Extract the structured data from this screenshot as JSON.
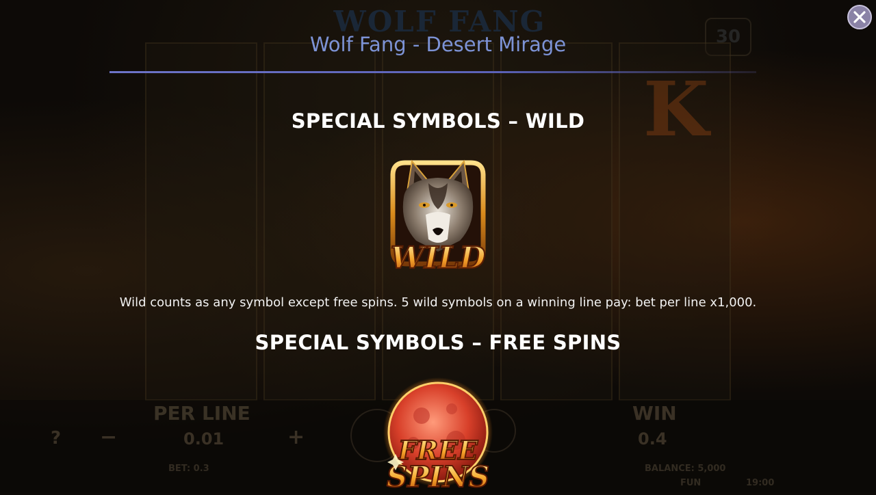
{
  "background": {
    "game_logo_text": "WOLF FANG",
    "lines_count": "30",
    "reel_letter": "K",
    "per_line_label": "PER LINE",
    "per_line_value": "0.01",
    "win_label": "WIN",
    "win_value": "0.4",
    "bet_text": "BET: 0.3",
    "balance_text": "BALANCE: 5,000",
    "fun_text": "FUN",
    "clock_text": "19:00",
    "help_glyph": "?",
    "minus_glyph": "−",
    "plus_glyph": "+"
  },
  "header": {
    "title": "Wolf Fang - Desert Mirage"
  },
  "sections": [
    {
      "heading": "SPECIAL SYMBOLS – WILD",
      "symbol_text": "WILD",
      "symbol_icon": "wolf-wild-icon",
      "description": "Wild counts as any symbol except free spins. 5 wild symbols on a winning line pay: bet per line x1,000."
    },
    {
      "heading": "SPECIAL SYMBOLS – FREE SPINS",
      "symbol_text_line1": "FREE",
      "symbol_text_line2": "SPINS",
      "symbol_icon": "red-moon-free-spins-icon"
    }
  ],
  "colors": {
    "title": "#7d93d6",
    "rule": "#6d74c8",
    "heading": "#ffffff",
    "gold": "#f2b134"
  }
}
